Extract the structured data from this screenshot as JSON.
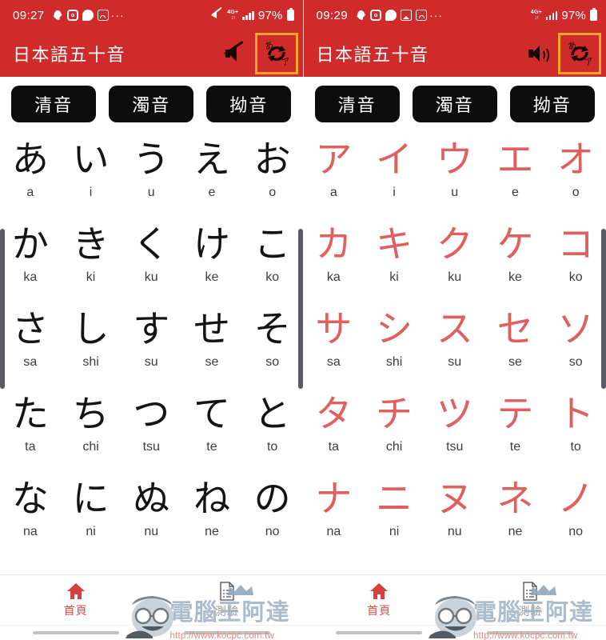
{
  "meta": {
    "app_title": "日本語五十音",
    "header_color": "#cf2b2b",
    "katakana_color": "#e0605f",
    "highlight_color": "#f5a623",
    "tab_bg_color": "#0d0d0d"
  },
  "panels": [
    {
      "id": "left",
      "statusbar": {
        "time": "09:27",
        "icons": [
          "bird-app-icon",
          "instagram-icon",
          "chat-bubble-icon",
          "wifi-app-icon"
        ],
        "overflow": "···",
        "mute_icon": "mute-icon",
        "network": "4G+",
        "network_arrows": "↓↑",
        "signal": "signal-bars-icon",
        "battery_percent": "97%",
        "battery_icon": "battery-icon"
      },
      "appbar": {
        "title": "日本語五十音",
        "sound_state": "muted",
        "sound_icon": "speaker-muted-icon",
        "swap_icon": "kana-swap-icon",
        "swap_hira": "あ",
        "swap_kata": "ア",
        "swap_highlighted": true
      },
      "tabs": [
        {
          "label": "清音",
          "selected": true
        },
        {
          "label": "濁音",
          "selected": false
        },
        {
          "label": "拗音",
          "selected": false
        }
      ],
      "kana_script": "hiragana",
      "rows": [
        {
          "chars": [
            "あ",
            "い",
            "う",
            "え",
            "お"
          ],
          "romaji": [
            "a",
            "i",
            "u",
            "e",
            "o"
          ]
        },
        {
          "chars": [
            "か",
            "き",
            "く",
            "け",
            "こ"
          ],
          "romaji": [
            "ka",
            "ki",
            "ku",
            "ke",
            "ko"
          ]
        },
        {
          "chars": [
            "さ",
            "し",
            "す",
            "せ",
            "そ"
          ],
          "romaji": [
            "sa",
            "shi",
            "su",
            "se",
            "so"
          ]
        },
        {
          "chars": [
            "た",
            "ち",
            "つ",
            "て",
            "と"
          ],
          "romaji": [
            "ta",
            "chi",
            "tsu",
            "te",
            "to"
          ]
        },
        {
          "chars": [
            "な",
            "に",
            "ぬ",
            "ね",
            "の"
          ],
          "romaji": [
            "na",
            "ni",
            "nu",
            "ne",
            "no"
          ]
        }
      ],
      "bottomnav": [
        {
          "label": "首頁",
          "icon": "home-icon",
          "active": true
        },
        {
          "label": "測驗",
          "icon": "document-test-icon",
          "active": false
        }
      ]
    },
    {
      "id": "right",
      "statusbar": {
        "time": "09:29",
        "icons": [
          "bird-app-icon",
          "instagram-icon",
          "chat-bubble-icon",
          "photo-icon",
          "wifi-app-icon"
        ],
        "overflow": "···",
        "mute_icon": null,
        "network": "4G+",
        "network_arrows": "↓↑",
        "signal": "signal-bars-icon",
        "battery_percent": "97%",
        "battery_icon": "battery-icon"
      },
      "appbar": {
        "title": "日本語五十音",
        "sound_state": "on",
        "sound_icon": "speaker-on-icon",
        "swap_icon": "kana-swap-icon",
        "swap_hira": "あ",
        "swap_kata": "ア",
        "swap_highlighted": true
      },
      "tabs": [
        {
          "label": "清音",
          "selected": true
        },
        {
          "label": "濁音",
          "selected": false
        },
        {
          "label": "拗音",
          "selected": false
        }
      ],
      "kana_script": "katakana",
      "rows": [
        {
          "chars": [
            "ア",
            "イ",
            "ウ",
            "エ",
            "オ"
          ],
          "romaji": [
            "a",
            "i",
            "u",
            "e",
            "o"
          ]
        },
        {
          "chars": [
            "カ",
            "キ",
            "ク",
            "ケ",
            "コ"
          ],
          "romaji": [
            "ka",
            "ki",
            "ku",
            "ke",
            "ko"
          ]
        },
        {
          "chars": [
            "サ",
            "シ",
            "ス",
            "セ",
            "ソ"
          ],
          "romaji": [
            "sa",
            "shi",
            "su",
            "se",
            "so"
          ]
        },
        {
          "chars": [
            "タ",
            "チ",
            "ツ",
            "テ",
            "ト"
          ],
          "romaji": [
            "ta",
            "chi",
            "tsu",
            "te",
            "to"
          ]
        },
        {
          "chars": [
            "ナ",
            "ニ",
            "ヌ",
            "ネ",
            "ノ"
          ],
          "romaji": [
            "na",
            "ni",
            "nu",
            "ne",
            "no"
          ]
        }
      ],
      "bottomnav": [
        {
          "label": "首頁",
          "icon": "home-icon",
          "active": true
        },
        {
          "label": "測驗",
          "icon": "document-test-icon",
          "active": false
        }
      ]
    }
  ],
  "watermark": {
    "text": "電腦王阿達",
    "url": "http://www.kocpc.com.tw"
  }
}
